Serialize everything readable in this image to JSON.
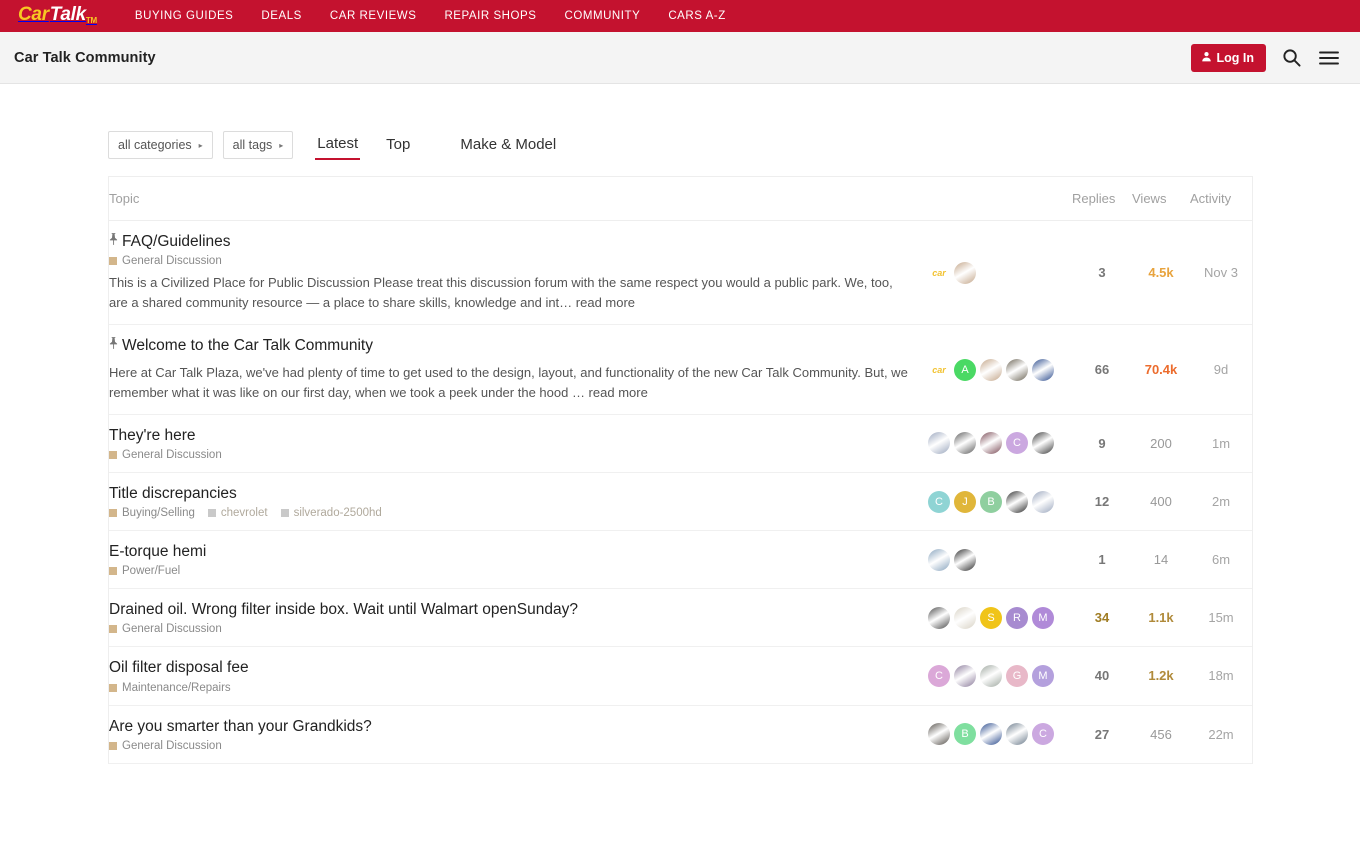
{
  "topnav": {
    "logo": {
      "part1": "Car",
      "part2": "Talk",
      "tm": "TM"
    },
    "links": [
      {
        "label": "BUYING GUIDES"
      },
      {
        "label": "DEALS"
      },
      {
        "label": "CAR REVIEWS"
      },
      {
        "label": "REPAIR SHOPS"
      },
      {
        "label": "COMMUNITY"
      },
      {
        "label": "CARS A-Z"
      }
    ]
  },
  "subheader": {
    "site_title": "Car Talk Community",
    "login_label": "Log In",
    "search_icon": "search-icon",
    "menu_icon": "hamburger-menu-icon"
  },
  "filters": {
    "categories_label": "all categories",
    "tags_label": "all tags",
    "caret": "▸",
    "tabs": [
      {
        "label": "Latest",
        "active": true
      },
      {
        "label": "Top",
        "active": false
      },
      {
        "label": "Make & Model",
        "active": false
      }
    ]
  },
  "table": {
    "headers": {
      "topic": "Topic",
      "posters": "",
      "replies": "Replies",
      "views": "Views",
      "activity": "Activity"
    },
    "rows": [
      {
        "pinned": true,
        "title": "FAQ/Guidelines",
        "category": "General Discussion",
        "tags": [],
        "excerpt": "This is a Civilized Place for Public Discussion Please treat this discussion forum with the same respect you would a public park. We, too, are a shared community resource — a place to share skills, knowledge and int… read more",
        "posters": [
          {
            "type": "logo",
            "label": "car"
          },
          {
            "type": "photo",
            "color": "#c3a588"
          }
        ],
        "replies": "3",
        "replies_hot": false,
        "views": "4.5k",
        "views_weight": "w3",
        "activity": "Nov 3"
      },
      {
        "pinned": true,
        "title": "Welcome to the Car Talk Community",
        "category": "",
        "tags": [],
        "excerpt": "Here at Car Talk Plaza, we've had plenty of time to get used to the design, layout, and functionality of the new Car Talk Community. But, we remember what it was like on our first day, when we took a peek under the hood … read more",
        "posters": [
          {
            "type": "logo",
            "label": "car"
          },
          {
            "type": "letter",
            "label": "A",
            "color": "#4ad964"
          },
          {
            "type": "photo",
            "color": "#c3a588"
          },
          {
            "type": "photo",
            "color": "#6b6455"
          },
          {
            "type": "photo",
            "color": "#2a4a8c"
          }
        ],
        "replies": "66",
        "replies_hot": false,
        "views": "70.4k",
        "views_weight": "w4",
        "activity": "9d"
      },
      {
        "pinned": false,
        "title": "They're here",
        "category": "General Discussion",
        "tags": [],
        "excerpt": "",
        "posters": [
          {
            "type": "photo",
            "color": "#9aa6bd"
          },
          {
            "type": "photo",
            "color": "#5c5c5c"
          },
          {
            "type": "photo",
            "color": "#7a4a55"
          },
          {
            "type": "letter",
            "label": "C",
            "color": "#cba8e0"
          },
          {
            "type": "photo",
            "color": "#3a3a3a"
          }
        ],
        "replies": "9",
        "replies_hot": false,
        "views": "200",
        "views_weight": "w1",
        "activity": "1m"
      },
      {
        "pinned": false,
        "title": "Title discrepancies",
        "category": "Buying/Selling",
        "tags": [
          "chevrolet",
          "silverado-2500hd"
        ],
        "excerpt": "",
        "posters": [
          {
            "type": "letter",
            "label": "C",
            "color": "#8fd4d4"
          },
          {
            "type": "letter",
            "label": "J",
            "color": "#e0b63a"
          },
          {
            "type": "letter",
            "label": "B",
            "color": "#8fcf9f"
          },
          {
            "type": "photo",
            "color": "#2b2b2b"
          },
          {
            "type": "photo",
            "color": "#9aa6bd"
          }
        ],
        "replies": "12",
        "replies_hot": false,
        "views": "400",
        "views_weight": "w1",
        "activity": "2m"
      },
      {
        "pinned": false,
        "title": "E-torque hemi",
        "category": "Power/Fuel",
        "tags": [],
        "excerpt": "",
        "posters": [
          {
            "type": "photo",
            "color": "#87a3bd"
          },
          {
            "type": "photo",
            "color": "#2b2b2b"
          }
        ],
        "replies": "1",
        "replies_hot": false,
        "views": "14",
        "views_weight": "w1",
        "activity": "6m"
      },
      {
        "pinned": false,
        "title": "Drained oil. Wrong filter inside box. Wait until Walmart openSunday?",
        "category": "General Discussion",
        "tags": [],
        "excerpt": "",
        "posters": [
          {
            "type": "photo",
            "color": "#4a4a4a"
          },
          {
            "type": "photo",
            "color": "#d8d2c4"
          },
          {
            "type": "letter",
            "label": "S",
            "color": "#f0c419"
          },
          {
            "type": "letter",
            "label": "R",
            "color": "#a78bd0"
          },
          {
            "type": "letter",
            "label": "M",
            "color": "#b08ad8"
          }
        ],
        "replies": "34",
        "replies_hot": true,
        "views": "1.1k",
        "views_weight": "w2",
        "activity": "15m"
      },
      {
        "pinned": false,
        "title": "Oil filter disposal fee",
        "category": "Maintenance/Repairs",
        "tags": [],
        "excerpt": "",
        "posters": [
          {
            "type": "letter",
            "label": "C",
            "color": "#dba8d8"
          },
          {
            "type": "photo",
            "color": "#8a7a9a"
          },
          {
            "type": "photo",
            "color": "#9fa8a0"
          },
          {
            "type": "letter",
            "label": "G",
            "color": "#e8b8c8"
          },
          {
            "type": "letter",
            "label": "M",
            "color": "#b4a0dd"
          }
        ],
        "replies": "40",
        "replies_hot": false,
        "views": "1.2k",
        "views_weight": "w2",
        "activity": "18m"
      },
      {
        "pinned": false,
        "title": "Are you smarter than your Grandkids?",
        "category": "General Discussion",
        "tags": [],
        "excerpt": "",
        "posters": [
          {
            "type": "photo",
            "color": "#55504a"
          },
          {
            "type": "letter",
            "label": "B",
            "color": "#7fdf9f"
          },
          {
            "type": "photo",
            "color": "#2a4a8c"
          },
          {
            "type": "photo",
            "color": "#6a7a8a"
          },
          {
            "type": "letter",
            "label": "C",
            "color": "#cba8e0"
          }
        ],
        "replies": "27",
        "replies_hot": false,
        "views": "456",
        "views_weight": "w1",
        "activity": "22m"
      }
    ]
  }
}
